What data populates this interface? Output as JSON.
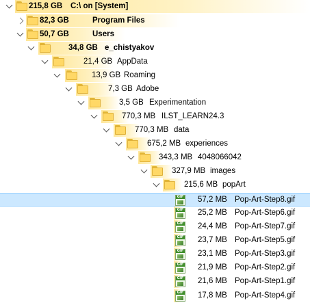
{
  "tree": [
    {
      "size": "215,8 GB",
      "label": "C:\\  on  [System]",
      "type": "folder",
      "state": "expanded",
      "bold": true
    },
    {
      "size": "82,3 GB",
      "label": "Program Files",
      "type": "folder",
      "state": "collapsed",
      "bold": true
    },
    {
      "size": "50,7 GB",
      "label": "Users",
      "type": "folder",
      "state": "expanded",
      "bold": true
    },
    {
      "size": "34,8 GB",
      "label": "e_chistyakov",
      "type": "folder",
      "state": "expanded",
      "bold": true
    },
    {
      "size": "21,4 GB",
      "label": "AppData",
      "type": "folder",
      "state": "expanded",
      "bold": false
    },
    {
      "size": "13,9 GB",
      "label": "Roaming",
      "type": "folder",
      "state": "expanded",
      "bold": false
    },
    {
      "size": "7,3 GB",
      "label": "Adobe",
      "type": "folder",
      "state": "expanded",
      "bold": false
    },
    {
      "size": "3,5 GB",
      "label": "Experimentation",
      "type": "folder",
      "state": "expanded",
      "bold": false
    },
    {
      "size": "770,3 MB",
      "label": "ILST_LEARN24.3",
      "type": "folder",
      "state": "expanded",
      "bold": false
    },
    {
      "size": "770,3 MB",
      "label": "data",
      "type": "folder",
      "state": "expanded",
      "bold": false
    },
    {
      "size": "675,2 MB",
      "label": "experiences",
      "type": "folder",
      "state": "expanded",
      "bold": false
    },
    {
      "size": "343,3 MB",
      "label": "4048066042",
      "type": "folder",
      "state": "expanded",
      "bold": false
    },
    {
      "size": "327,9 MB",
      "label": "images",
      "type": "folder",
      "state": "expanded",
      "bold": false
    },
    {
      "size": "215,6 MB",
      "label": "popArt",
      "type": "folder",
      "state": "expanded",
      "bold": false
    },
    {
      "size": "57,2 MB",
      "label": "Pop-Art-Step8.gif",
      "type": "gif",
      "state": "none",
      "bold": false,
      "selected": true
    },
    {
      "size": "25,2 MB",
      "label": "Pop-Art-Step6.gif",
      "type": "gif",
      "state": "none",
      "bold": false
    },
    {
      "size": "24,4 MB",
      "label": "Pop-Art-Step7.gif",
      "type": "gif",
      "state": "none",
      "bold": false
    },
    {
      "size": "23,7 MB",
      "label": "Pop-Art-Step5.gif",
      "type": "gif",
      "state": "none",
      "bold": false
    },
    {
      "size": "23,1 MB",
      "label": "Pop-Art-Step3.gif",
      "type": "gif",
      "state": "none",
      "bold": false
    },
    {
      "size": "21,9 MB",
      "label": "Pop-Art-Step2.gif",
      "type": "gif",
      "state": "none",
      "bold": false
    },
    {
      "size": "21,6 MB",
      "label": "Pop-Art-Step1.gif",
      "type": "gif",
      "state": "none",
      "bold": false
    },
    {
      "size": "17,8 MB",
      "label": "Pop-Art-Step4.gif",
      "type": "gif",
      "state": "none",
      "bold": false
    }
  ],
  "icons": {
    "folder": "folder-icon",
    "gif": "gif-file-icon",
    "expanded": "chevron-down-icon",
    "collapsed": "chevron-right-icon"
  },
  "colors": {
    "bar": "#ffe79a",
    "selection": "#cce8ff",
    "folder": "#ffd866"
  }
}
